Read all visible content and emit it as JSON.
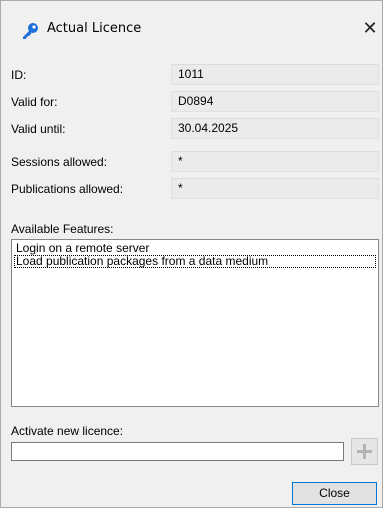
{
  "window": {
    "title": "Actual Licence",
    "close_glyph": "✕",
    "title_icon": "key-icon"
  },
  "licence": {
    "id_label": "ID:",
    "id_value": "1011",
    "valid_for_label": "Valid for:",
    "valid_for_value": "D0894",
    "valid_until_label": "Valid until:",
    "valid_until_value": "30.04.2025",
    "sessions_label": "Sessions allowed:",
    "sessions_value": "*",
    "publications_label": "Publications allowed:",
    "publications_value": "*"
  },
  "features": {
    "label": "Available Features:",
    "items": [
      "Login on a remote server",
      "Load publication packages from a data medium"
    ]
  },
  "activate": {
    "label": "Activate new licence:",
    "input_value": "",
    "add_icon": "plus-icon"
  },
  "footer": {
    "close_label": "Close"
  },
  "colors": {
    "key_icon": "#1e6fd9",
    "accent_border": "#0078d7"
  }
}
